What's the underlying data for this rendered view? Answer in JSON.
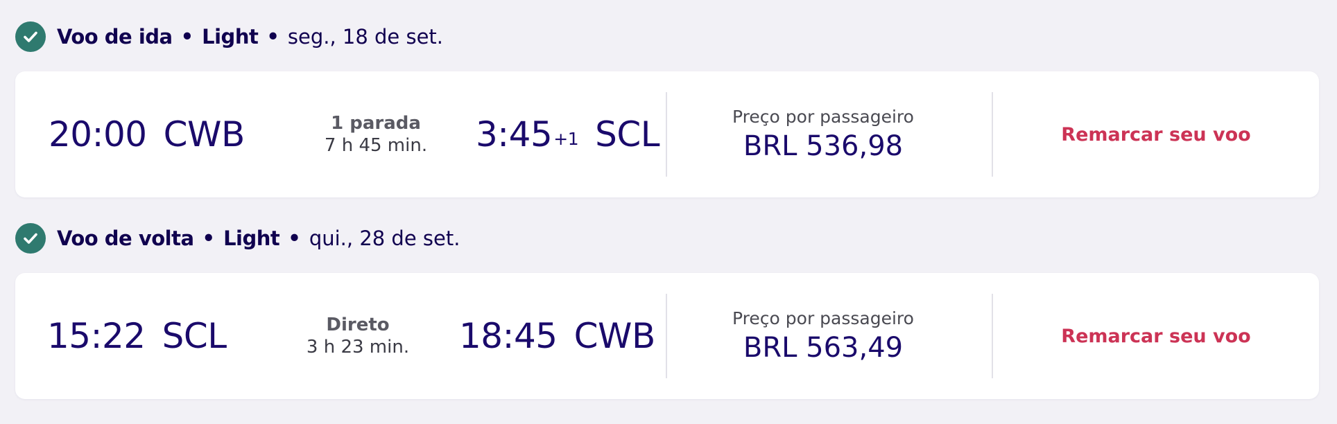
{
  "colors": {
    "background": "#f2f1f6",
    "primary_text": "#10004f",
    "check_icon": "#2f7a6f",
    "rebook_link": "#cc3355"
  },
  "outbound": {
    "header": {
      "icon": "check-circle-icon",
      "title": "Voo de ida",
      "fare": "Light",
      "date": "seg., 18 de set."
    },
    "departure_time": "20:00",
    "origin": "CWB",
    "stops": "1 parada",
    "duration": "7 h 45 min.",
    "arrival_time": "3:45",
    "day_offset": "+1",
    "destination": "SCL",
    "price_label": "Preço por passageiro",
    "price": "BRL 536,98",
    "action_label": "Remarcar seu voo"
  },
  "return": {
    "header": {
      "icon": "check-circle-icon",
      "title": "Voo de volta",
      "fare": "Light",
      "date": "qui., 28 de set."
    },
    "departure_time": "15:22",
    "origin": "SCL",
    "stops": "Direto",
    "duration": "3 h 23 min.",
    "arrival_time": "18:45",
    "destination": "CWB",
    "price_label": "Preço por passageiro",
    "price": "BRL 563,49",
    "action_label": "Remarcar seu voo"
  }
}
